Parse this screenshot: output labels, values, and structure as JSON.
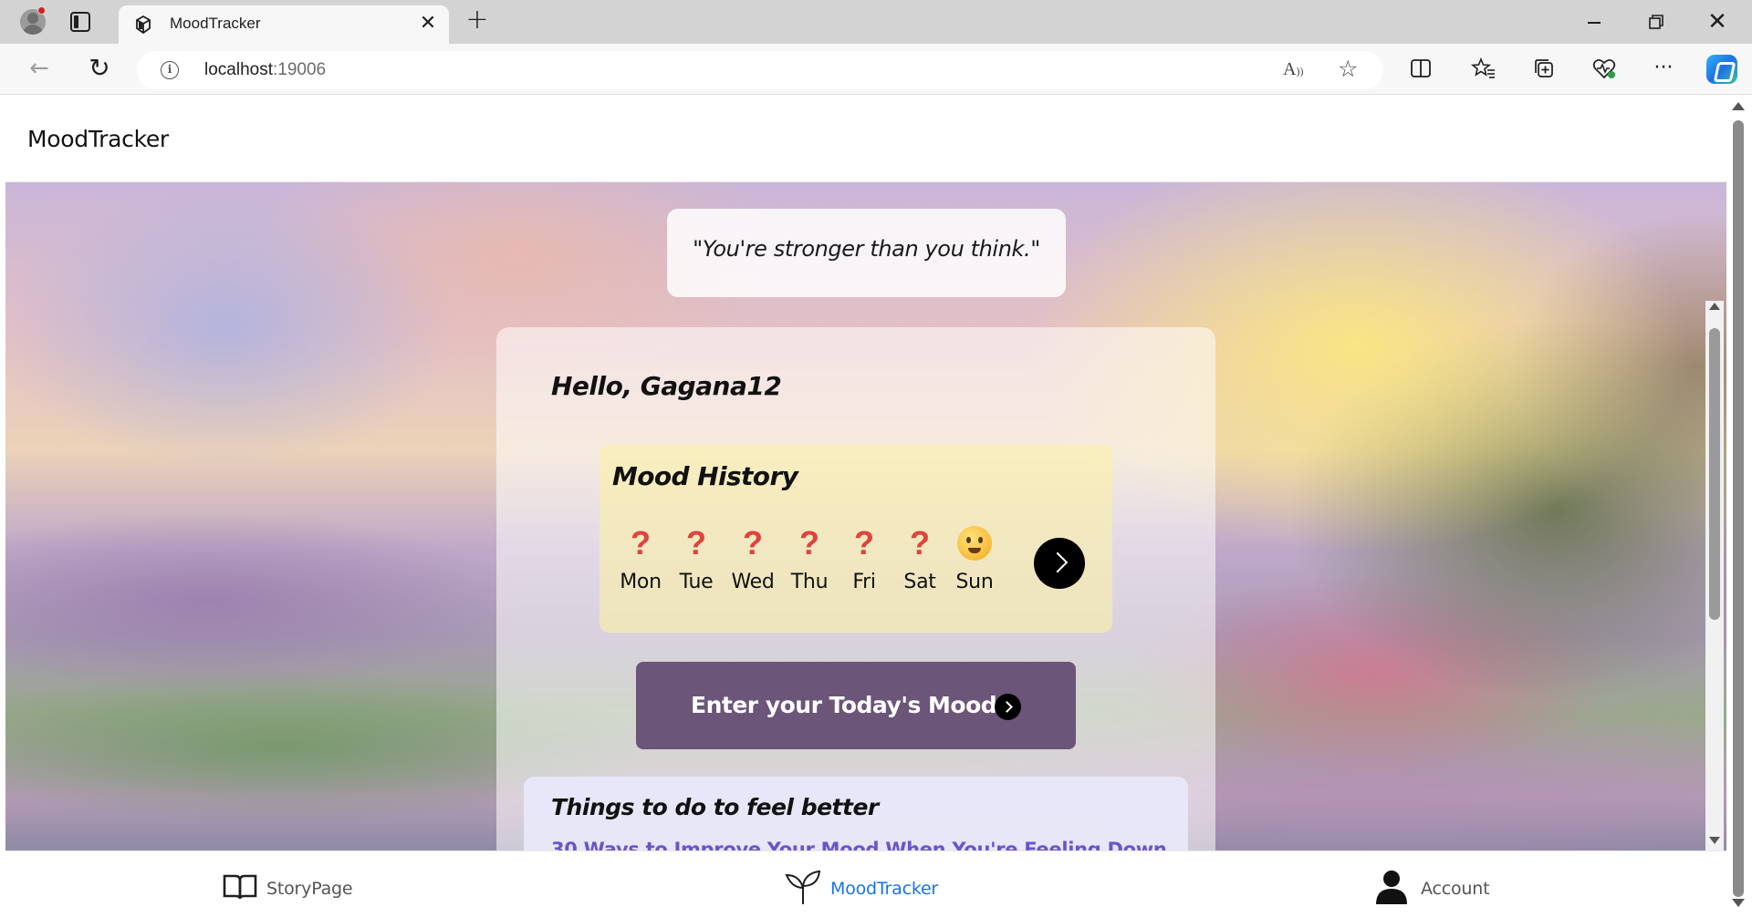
{
  "browser": {
    "tab_title": "MoodTracker",
    "url_host": "localhost",
    "url_port": ":19006",
    "icons": [
      "profile-icon",
      "tab-actions-icon",
      "app-favicon",
      "close-tab-icon",
      "new-tab-icon",
      "back-icon",
      "refresh-icon",
      "site-info-icon",
      "read-aloud-icon",
      "favorite-star-icon",
      "split-screen-icon",
      "favorites-icon",
      "collections-icon",
      "browser-essentials-icon",
      "more-icon",
      "copilot-icon",
      "minimize-icon",
      "restore-icon",
      "close-window-icon"
    ]
  },
  "app": {
    "header_title": "MoodTracker"
  },
  "quote": {
    "text": "\"You're stronger than you think.\""
  },
  "greeting": {
    "text": "Hello, Gagana12"
  },
  "mood_history": {
    "title": "Mood History",
    "days": [
      {
        "label": "Mon",
        "mark": "?"
      },
      {
        "label": "Tue",
        "mark": "?"
      },
      {
        "label": "Wed",
        "mark": "?"
      },
      {
        "label": "Thu",
        "mark": "?"
      },
      {
        "label": "Fri",
        "mark": "?"
      },
      {
        "label": "Sat",
        "mark": "?"
      },
      {
        "label": "Sun",
        "mark": "smiling-emoji"
      }
    ],
    "mark_color": "#e0433b"
  },
  "today_button": {
    "label": "Enter your Today's Mood",
    "bg_color": "#6b5578"
  },
  "tips": {
    "title": "Things to do to feel better",
    "link_text": "30 Ways to Improve Your Mood When You're Feeling Down",
    "link_color": "#6a55c8"
  },
  "bottom_nav": {
    "items": [
      {
        "label": "StoryPage",
        "icon": "book-icon",
        "active": false
      },
      {
        "label": "MoodTracker",
        "icon": "sprout-icon",
        "active": true
      },
      {
        "label": "Account",
        "icon": "person-icon",
        "active": false
      }
    ],
    "active_color": "#1a73e8",
    "inactive_color": "#555555"
  }
}
